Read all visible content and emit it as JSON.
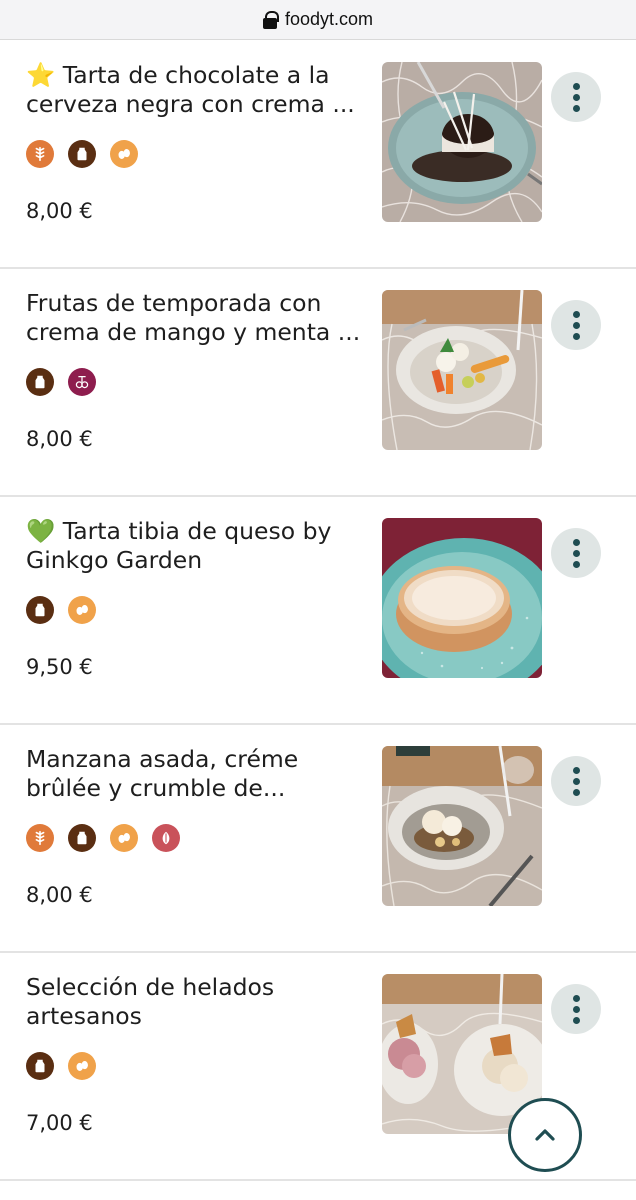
{
  "browser": {
    "url": "foodyt.com"
  },
  "items": [
    {
      "title": "⭐ Tarta de chocolate a la cerveza negra con crema ...",
      "price": "8,00 €",
      "allergens": [
        "gluten-icon",
        "milk-icon",
        "eggs-icon"
      ]
    },
    {
      "title": "Frutas de temporada con crema de mango y menta ...",
      "price": "8,00 €",
      "allergens": [
        "milk-icon",
        "sulphites-icon"
      ]
    },
    {
      "title": "💚 Tarta tibia de queso by Ginkgo Garden",
      "price": "9,50 €",
      "allergens": [
        "milk-icon",
        "eggs-icon"
      ]
    },
    {
      "title": "Manzana asada, créme brûlée y crumble de...",
      "price": "8,00 €",
      "allergens": [
        "gluten-icon",
        "milk-icon",
        "eggs-icon",
        "nuts-icon"
      ]
    },
    {
      "title": "Selección de helados artesanos",
      "price": "7,00 €",
      "allergens": [
        "milk-icon",
        "eggs-icon"
      ]
    }
  ],
  "colors": {
    "gluten": "#e07a3a",
    "milk": "#5a2e12",
    "eggs": "#f0a24a",
    "sulphites": "#8e1d4e",
    "nuts": "#c9525a",
    "accent": "#1f4d52"
  }
}
